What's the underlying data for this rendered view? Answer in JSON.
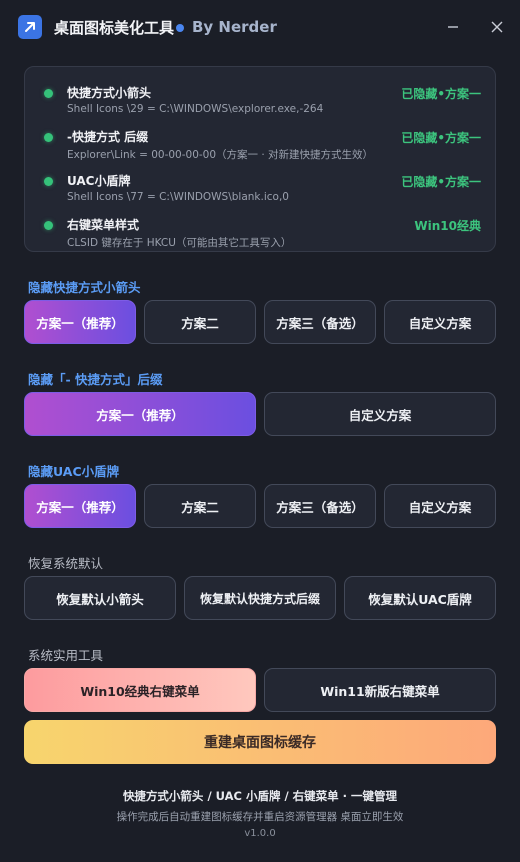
{
  "window": {
    "title": "桌面图标美化工具",
    "author": "By Nerder",
    "accent": "#3b74e4"
  },
  "status": {
    "items": [
      {
        "name": "快捷方式小箭头",
        "detail": "Shell Icons \\29 = C:\\WINDOWS\\explorer.exe,-264",
        "value": "已隐藏•方案一"
      },
      {
        "name": "-快捷方式 后缀",
        "detail": "Explorer\\Link = 00-00-00-00（方案一 · 对新建快捷方式生效）",
        "value": "已隐藏•方案一"
      },
      {
        "name": "UAC小盾牌",
        "detail": "Shell Icons \\77 = C:\\WINDOWS\\blank.ico,0",
        "value": "已隐藏•方案一"
      },
      {
        "name": "右键菜单样式",
        "detail": "CLSID 键存在于 HKCU（可能由其它工具写入）",
        "value": "Win10经典"
      }
    ],
    "ok_color": "#3cc47e"
  },
  "sections": {
    "arrow": {
      "label": "隐藏快捷方式小箭头",
      "buttons": [
        "方案一（推荐）",
        "方案二",
        "方案三（备选）",
        "自定义方案"
      ],
      "active": 0
    },
    "suffix": {
      "label": "隐藏「- 快捷方式」后缀",
      "buttons": [
        "方案一（推荐）",
        "自定义方案"
      ],
      "active": 0
    },
    "uac": {
      "label": "隐藏UAC小盾牌",
      "buttons": [
        "方案一（推荐）",
        "方案二",
        "方案三（备选）",
        "自定义方案"
      ],
      "active": 0
    },
    "restore": {
      "label": "恢复系统默认",
      "buttons": [
        "恢复默认小箭头",
        "恢复默认快捷方式后缀",
        "恢复默认UAC盾牌"
      ]
    },
    "tools": {
      "label": "系统实用工具",
      "buttons": [
        "Win10经典右键菜单",
        "Win11新版右键菜单"
      ],
      "rebuild": "重建桌面图标缓存"
    }
  },
  "footer": {
    "main": "快捷方式小箭头 / UAC 小盾牌 / 右键菜单 · 一键管理",
    "sub": "操作完成后自动重建图标缓存并重启资源管理器 桌面立即生效",
    "version": "v1.0.0"
  }
}
